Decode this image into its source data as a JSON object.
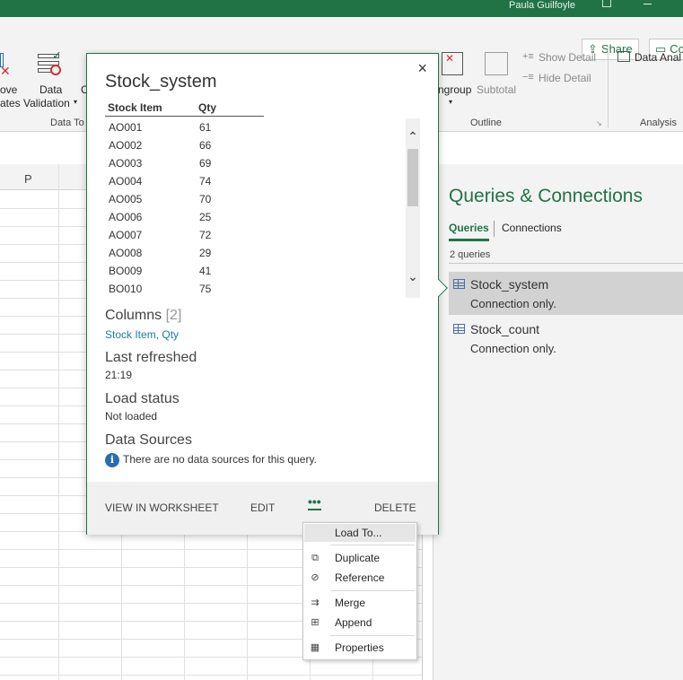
{
  "titlebar": {
    "user": "Paula Guilfoyle"
  },
  "ribbon": {
    "share": "Share",
    "comments": "Co",
    "remove_dup_l1": "ove",
    "remove_dup_l2": "ates",
    "data_validation_l1": "Data",
    "data_validation_l2": "Validation",
    "data_tools_label": "Data To",
    "c_label": "C",
    "ungroup": "ngroup",
    "subtotal": "Subtotal",
    "show_detail": "Show Detail",
    "hide_detail": "Hide Detail",
    "outline_label": "Outline",
    "data_analysis": "Data Anal",
    "analysis_label": "Analysis"
  },
  "sheet": {
    "col_p": "P"
  },
  "pane": {
    "title": "Queries & Connections",
    "tabs": [
      {
        "label": "Queries"
      },
      {
        "label": "Connections"
      }
    ],
    "count": "2 queries",
    "queries": [
      {
        "name": "Stock_system",
        "status": "Connection only."
      },
      {
        "name": "Stock_count",
        "status": "Connection only."
      }
    ]
  },
  "card": {
    "title": "Stock_system",
    "close": "×",
    "table": {
      "headers": [
        "Stock Item",
        "Qty"
      ],
      "rows": [
        [
          "AO001",
          "61"
        ],
        [
          "AO002",
          "66"
        ],
        [
          "AO003",
          "69"
        ],
        [
          "AO004",
          "74"
        ],
        [
          "AO005",
          "70"
        ],
        [
          "AO006",
          "25"
        ],
        [
          "AO007",
          "72"
        ],
        [
          "AO008",
          "29"
        ],
        [
          "BO009",
          "41"
        ],
        [
          "BO010",
          "75"
        ]
      ]
    },
    "columns_label": "Columns",
    "columns_count": "[2]",
    "columns_col1": "Stock Item",
    "columns_col2": "Qty",
    "last_refreshed_label": "Last refreshed",
    "last_refreshed_value": "21:19",
    "load_status_label": "Load status",
    "load_status_value": "Not loaded",
    "data_sources_label": "Data Sources",
    "data_sources_value": "There are no data sources for this query.",
    "footer": {
      "view": "VIEW IN WORKSHEET",
      "edit": "EDIT",
      "more": "•••",
      "delete": "DELETE"
    }
  },
  "menu": {
    "items": [
      {
        "label": "Load To..."
      },
      {
        "label": "Duplicate"
      },
      {
        "label": "Reference"
      },
      {
        "label": "Merge"
      },
      {
        "label": "Append"
      },
      {
        "label": "Properties"
      }
    ]
  }
}
